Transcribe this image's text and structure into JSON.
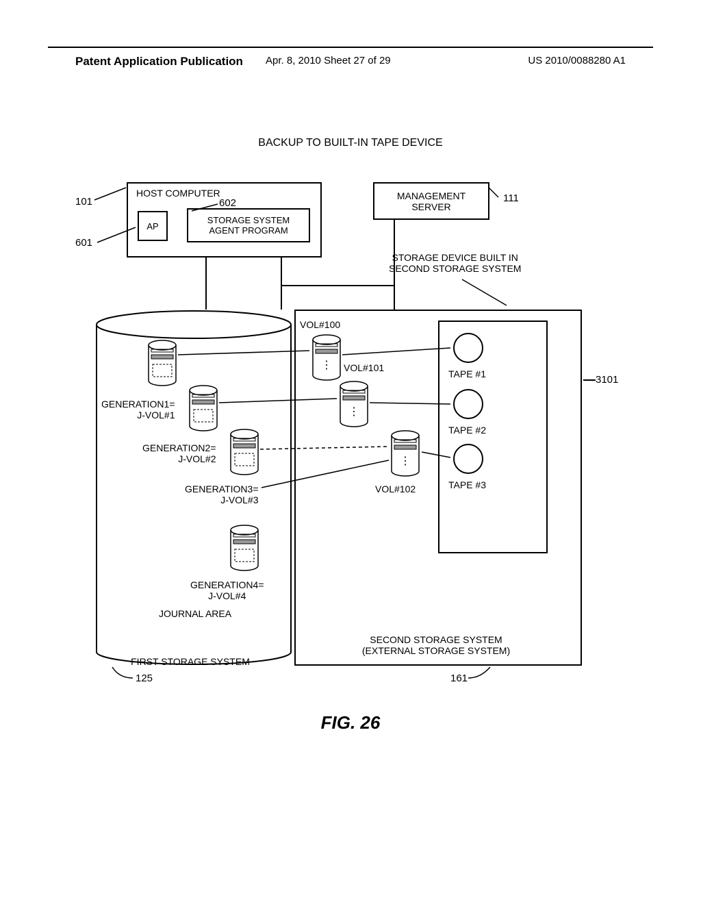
{
  "header": {
    "left": "Patent Application Publication",
    "mid": "Apr. 8, 2010  Sheet 27 of 29",
    "right": "US 2010/0088280 A1"
  },
  "title": "BACKUP TO BUILT-IN TAPE DEVICE",
  "host": {
    "label": "HOST COMPUTER",
    "ap": "AP",
    "agent": "STORAGE SYSTEM\nAGENT PROGRAM"
  },
  "mgmt": "MANAGEMENT\nSERVER",
  "storage_device_label": "STORAGE DEVICE BUILT IN\nSECOND STORAGE SYSTEM",
  "first_storage": {
    "journal_area": "JOURNAL AREA",
    "label": "FIRST STORAGE SYSTEM",
    "gens": [
      "GENERATION1=\nJ-VOL#1",
      "GENERATION2=\nJ-VOL#2",
      "GENERATION3=\nJ-VOL#3",
      "GENERATION4=\nJ-VOL#4"
    ]
  },
  "second_storage": {
    "label": "SECOND STORAGE SYSTEM\n(EXTERNAL STORAGE SYSTEM)",
    "vols": [
      "VOL#100",
      "VOL#101",
      "VOL#102"
    ],
    "tapes": [
      "TAPE #1",
      "TAPE #2",
      "TAPE #3"
    ]
  },
  "callouts": {
    "c101": "101",
    "c601": "601",
    "c602": "602",
    "c111": "111",
    "c3101": "3101",
    "c125": "125",
    "c161": "161"
  },
  "fig": "FIG. 26"
}
